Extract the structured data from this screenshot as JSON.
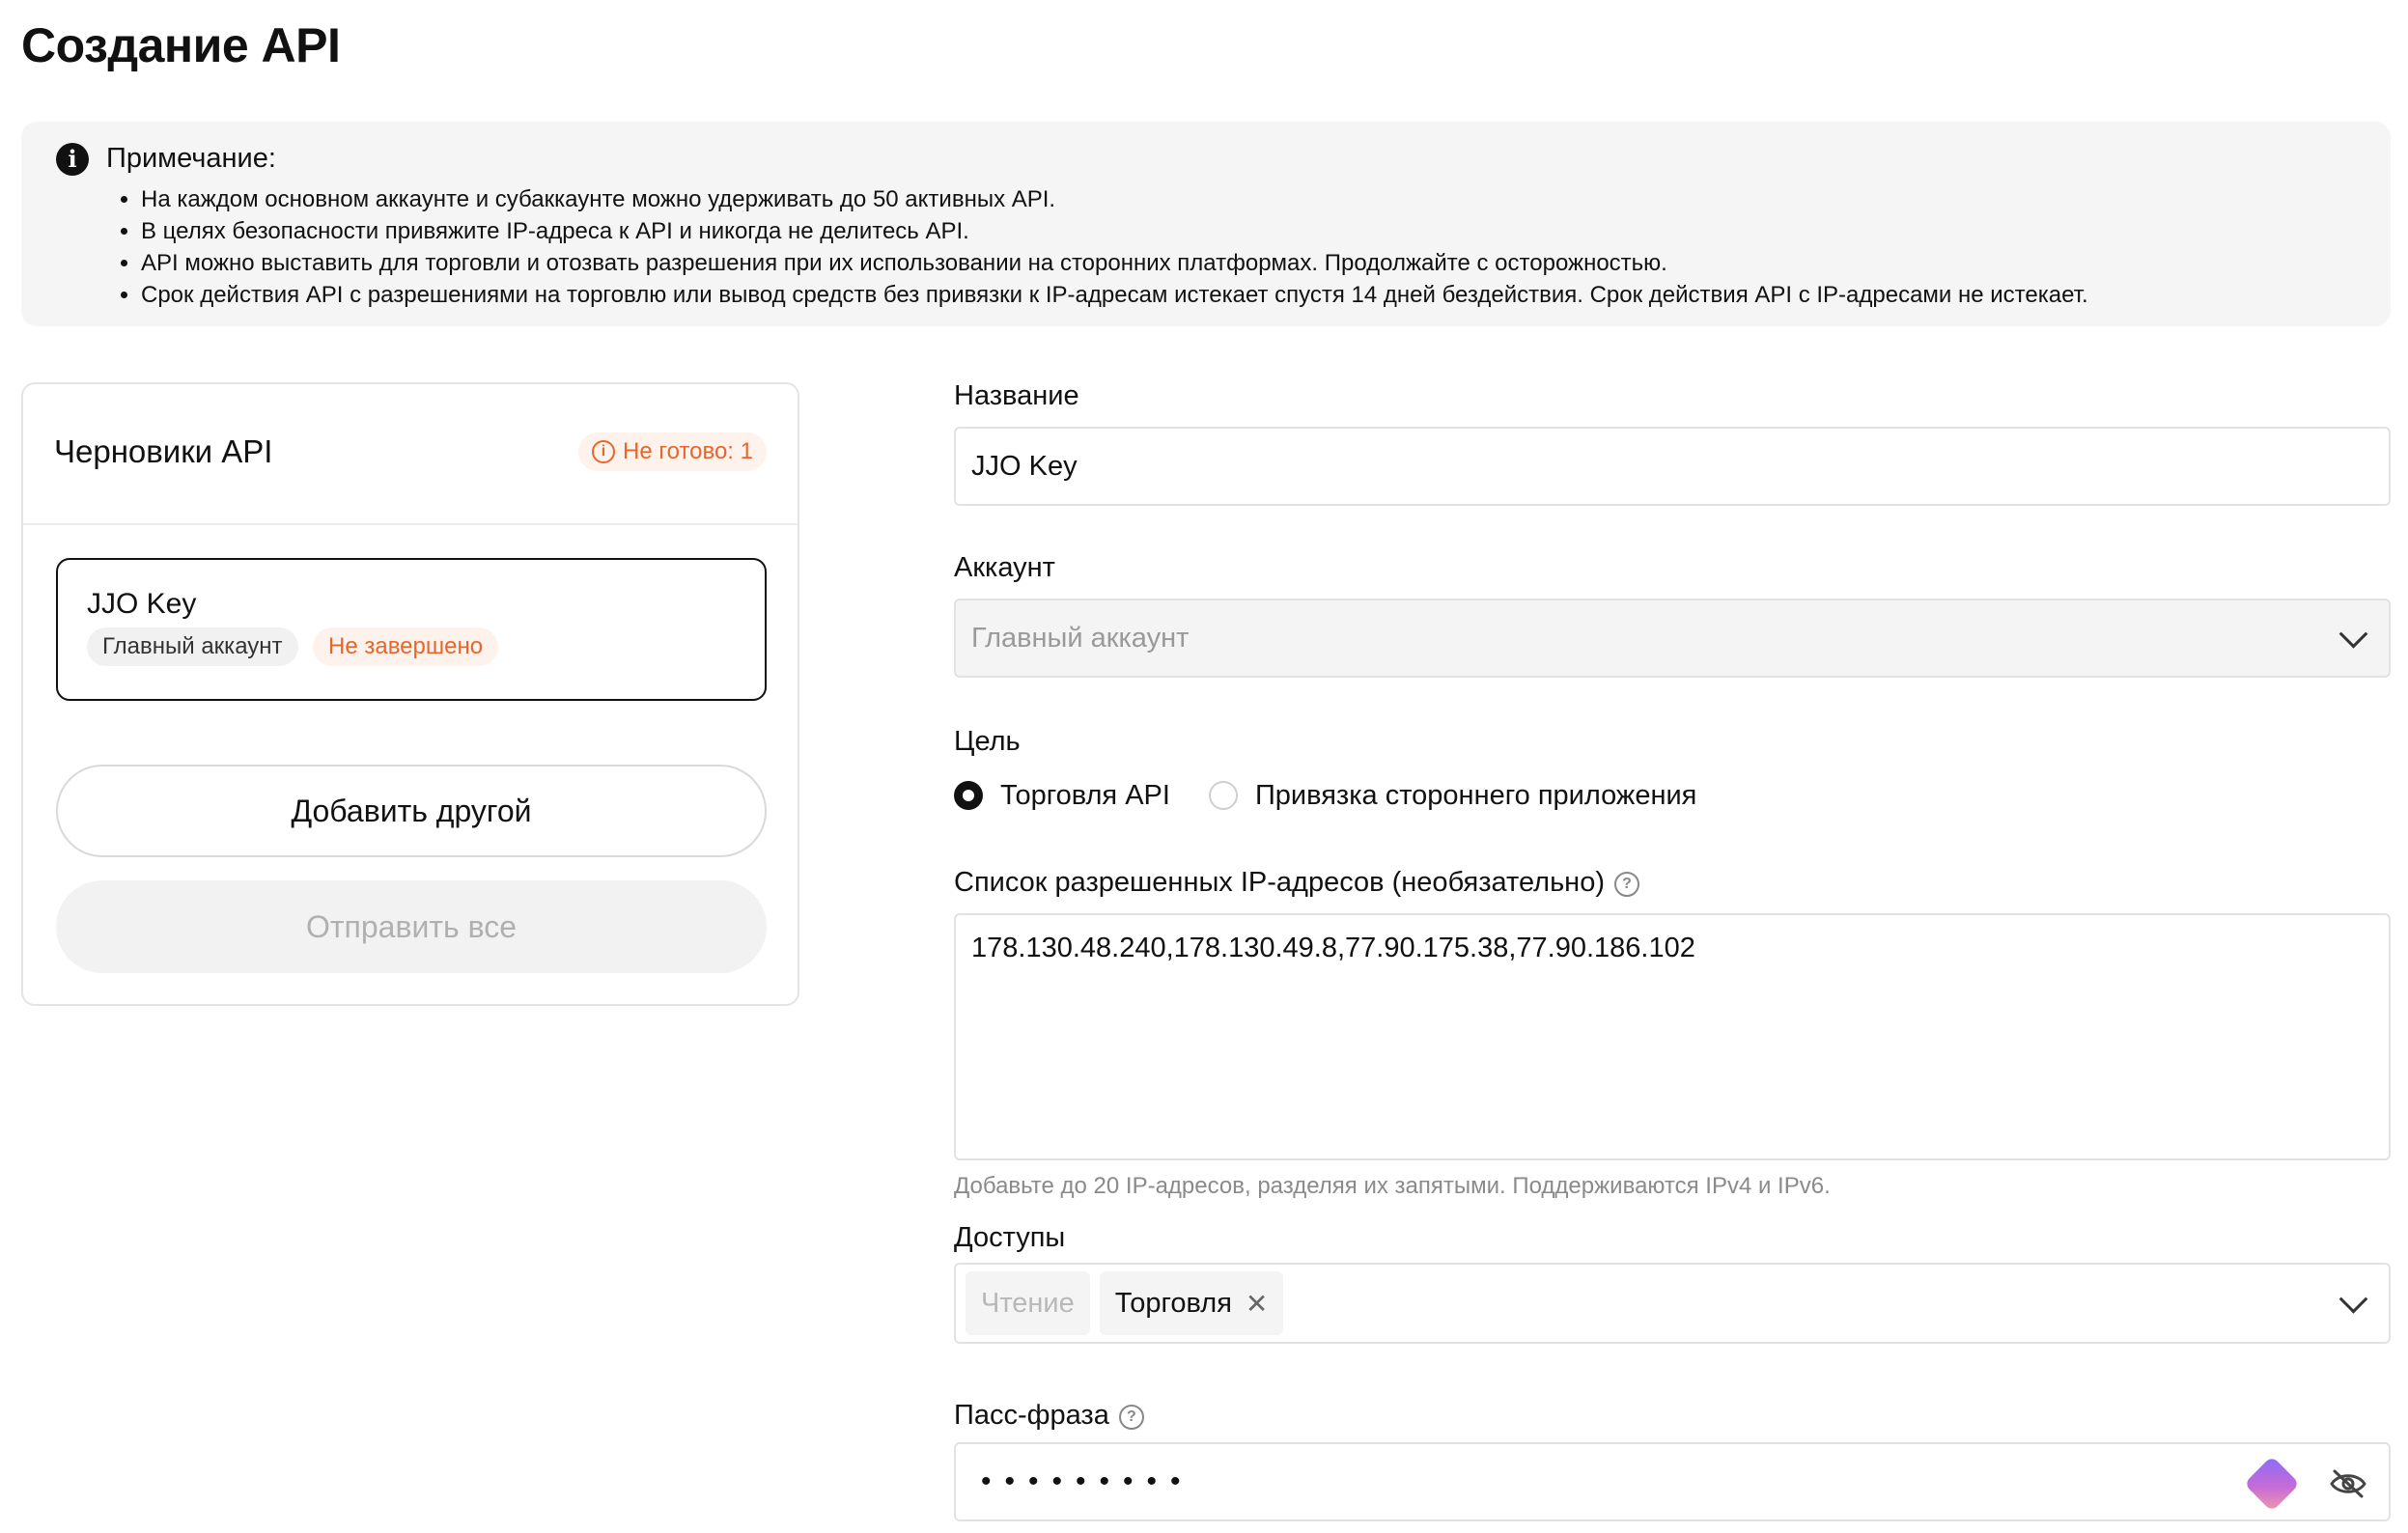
{
  "page": {
    "title": "Создание API"
  },
  "notice": {
    "title": "Примечание:",
    "items": [
      "На каждом основном аккаунте и субаккаунте можно удерживать до 50 активных API.",
      "В целях безопасности привяжите IP-адреса к API и никогда не делитесь API.",
      "API можно выставить для торговли и отозвать разрешения при их использовании на сторонних платформах. Продолжайте с осторожностью.",
      "Срок действия API с разрешениями на торговлю или вывод средств без привязки к IP-адресам истекает спустя 14 дней бездействия. Срок действия API с IP-адресами не истекает."
    ]
  },
  "drafts": {
    "title": "Черновики API",
    "status": "Не готово: 1",
    "items": [
      {
        "name": "JJO Key",
        "account": "Главный аккаунт",
        "status": "Не завершено"
      }
    ],
    "add_label": "Добавить другой",
    "submit_label": "Отправить все"
  },
  "form": {
    "name": {
      "label": "Название",
      "value": "JJO Key"
    },
    "account": {
      "label": "Аккаунт",
      "value": "Главный аккаунт"
    },
    "purpose": {
      "label": "Цель",
      "options": [
        "Торговля API",
        "Привязка стороннего приложения"
      ],
      "selected": "Торговля API"
    },
    "ip_whitelist": {
      "label": "Список разрешенных IP-адресов (необязательно)",
      "value": "178.130.48.240,178.130.49.8,77.90.175.38,77.90.186.102",
      "hint": "Добавьте до 20 IP-адресов, разделяя их запятыми. Поддерживаются IPv4 и IPv6."
    },
    "permissions": {
      "label": "Доступы",
      "chips": [
        {
          "label": "Чтение",
          "removable": false
        },
        {
          "label": "Торговля",
          "removable": true
        }
      ]
    },
    "passphrase": {
      "label": "Пасс-фраза",
      "masked_value": "•••••••••"
    }
  },
  "colors": {
    "accent_orange": "#e8662c",
    "text": "#111111",
    "muted": "#8a8a8a"
  }
}
